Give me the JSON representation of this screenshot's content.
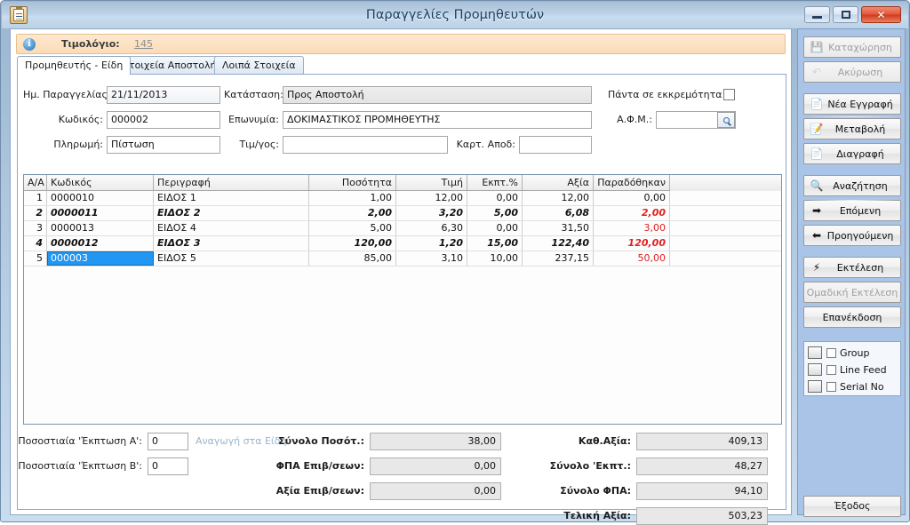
{
  "window": {
    "title": "Παραγγελίες Προμηθευτών",
    "icon": "clipboard-icon",
    "minimize": "minimize-icon",
    "maximize": "maximize-icon",
    "close": "✕"
  },
  "info_strip": {
    "icon": "info-icon",
    "icon_glyph": "i",
    "label": "Τιμολόγιο:",
    "link": "145"
  },
  "tabs": [
    {
      "label": "Προμηθευτής - Είδη",
      "active": true
    },
    {
      "label": "Στοιχεία Αποστολής",
      "active": false
    },
    {
      "label": "Λοιπά Στοιχεία",
      "active": false
    }
  ],
  "form": {
    "order_date_label": "Ημ. Παραγγελίας:",
    "order_date_value": "21/11/2013",
    "status_label": "Κατάσταση:",
    "status_value": "Προς Αποστολή",
    "always_pending_label": "Πάντα σε εκκρεμότητα",
    "always_pending_checked": false,
    "code_label": "Κωδικός:",
    "code_value": "000002",
    "name_label": "Επωνυμία:",
    "name_value": "ΔΟΚΙΜΑΣΤΙΚΟΣ ΠΡΟΜΗΘΕΥΤΗΣ",
    "vat_label": "Α.Φ.Μ.:",
    "vat_value": "",
    "vat_search_icon": "search-icon",
    "payment_label": "Πληρωμή:",
    "payment_value": "Πίστωση",
    "invoice_label": "Τιμ/γος:",
    "invoice_value": "",
    "receipt_card_label": "Καρτ. Αποδ:",
    "receipt_card_value": ""
  },
  "grid": {
    "columns": [
      "Α/Α",
      "Κωδικός",
      "Περιγραφή",
      "Ποσότητα",
      "Τιμή",
      "Εκπτ.%",
      "Αξία",
      "Παραδόθηκαν"
    ],
    "rows": [
      {
        "aa": "1",
        "code": "0000010",
        "desc": "ΕΙΔΟΣ 1",
        "qty": "1,00",
        "price": "12,00",
        "disc": "0,00",
        "value": "12,00",
        "delivered": "0,00",
        "emphasis": false,
        "delivered_red": false,
        "selected": false
      },
      {
        "aa": "2",
        "code": "0000011",
        "desc": "ΕΙΔΟΣ 2",
        "qty": "2,00",
        "price": "3,20",
        "disc": "5,00",
        "value": "6,08",
        "delivered": "2,00",
        "emphasis": true,
        "delivered_red": true,
        "selected": false
      },
      {
        "aa": "3",
        "code": "0000013",
        "desc": "ΕΙΔΟΣ 4",
        "qty": "5,00",
        "price": "6,30",
        "disc": "0,00",
        "value": "31,50",
        "delivered": "3,00",
        "emphasis": false,
        "delivered_red": true,
        "selected": false
      },
      {
        "aa": "4",
        "code": "0000012",
        "desc": "ΕΙΔΟΣ 3",
        "qty": "120,00",
        "price": "1,20",
        "disc": "15,00",
        "value": "122,40",
        "delivered": "120,00",
        "emphasis": true,
        "delivered_red": true,
        "selected": false
      },
      {
        "aa": "5",
        "code": "000003",
        "desc": "ΕΙΔΟΣ 5",
        "qty": "85,00",
        "price": "3,10",
        "disc": "10,00",
        "value": "237,15",
        "delivered": "50,00",
        "emphasis": false,
        "delivered_red": true,
        "selected": true
      }
    ]
  },
  "totals": {
    "discount_a_label": "Ποσοστιαία 'Έκπτωση  Α':",
    "discount_a_value": "0",
    "discount_b_label": "Ποσοστιαία 'Έκπτωση  Β':",
    "discount_b_value": "0",
    "apply_link": "Αναγωγή στα Είδη",
    "sum_qty_label": "Σύνολο Ποσότ.:",
    "sum_qty_value": "38,00",
    "vat_charges_label": "ΦΠΑ Επιβ/σεων:",
    "vat_charges_value": "0,00",
    "value_charges_label": "Αξία Επιβ/σεων:",
    "value_charges_value": "0,00",
    "net_value_label": "Καθ.Αξία:",
    "net_value_value": "409,13",
    "sum_discount_label": "Σύνολο 'Εκπτ.:",
    "sum_discount_value": "48,27",
    "sum_vat_label": "Σύνολο ΦΠΑ:",
    "sum_vat_value": "94,10",
    "final_value_label": "Τελική Αξία:",
    "final_value_value": "503,23"
  },
  "sidebar": {
    "buttons": [
      {
        "label": "Καταχώρηση",
        "icon": "save-icon",
        "glyph": "💾",
        "disabled": true
      },
      {
        "label": "Ακύρωση",
        "icon": "undo-icon",
        "glyph": "↶",
        "disabled": true
      },
      {
        "label": "Νέα Εγγραφή",
        "icon": "new-page-icon",
        "glyph": "📄",
        "disabled": false
      },
      {
        "label": "Μεταβολή",
        "icon": "edit-icon",
        "glyph": "📝",
        "disabled": false
      },
      {
        "label": "Διαγραφή",
        "icon": "delete-icon",
        "glyph": "📄",
        "disabled": false
      },
      {
        "label": "Αναζήτηση",
        "icon": "search-icon",
        "glyph": "🔍",
        "disabled": false
      },
      {
        "label": "Επόμενη",
        "icon": "arrow-right-icon",
        "glyph": "➡",
        "disabled": false
      },
      {
        "label": "Προηγούμενη",
        "icon": "arrow-left-icon",
        "glyph": "⬅",
        "disabled": false
      },
      {
        "label": "Εκτέλεση",
        "icon": "lightning-icon",
        "glyph": "⚡",
        "disabled": false
      },
      {
        "label": "Ομαδική Εκτέλεση",
        "icon": "none",
        "glyph": "",
        "disabled": true
      },
      {
        "label": "Επανέκδοση",
        "icon": "none",
        "glyph": "",
        "disabled": false
      }
    ],
    "options": [
      {
        "label": "Group",
        "icon": "group-icon",
        "checked": false
      },
      {
        "label": "Line Feed",
        "icon": "line-feed-icon",
        "checked": false
      },
      {
        "label": "Serial No",
        "icon": "serial-no-icon",
        "checked": false
      }
    ],
    "exit_label": "Έξοδος"
  },
  "colors": {
    "titlebar": "#bcd2e6",
    "sidebar": "#a9c4e6",
    "info_strip": "#fbdcb8",
    "selection": "#2196f3",
    "alert_red": "#e02020"
  }
}
